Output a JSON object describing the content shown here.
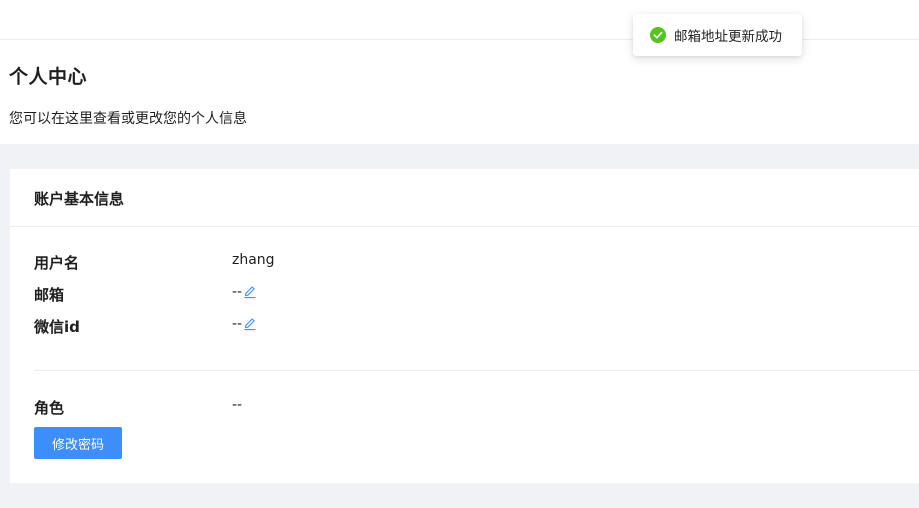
{
  "header": {
    "title": "个人中心",
    "description": "您可以在这里查看或更改您的个人信息"
  },
  "card": {
    "title": "账户基本信息",
    "fields": [
      {
        "label": "用户名",
        "value": "zhang",
        "editable": false
      },
      {
        "label": "邮箱",
        "value": "--",
        "editable": true,
        "icon": "edit-icon"
      },
      {
        "label": "微信id",
        "value": "--",
        "editable": true,
        "icon": "edit-icon"
      }
    ],
    "role": {
      "label": "角色",
      "value": "--"
    },
    "change_password_label": "修改密码"
  },
  "toast": {
    "message": "邮箱地址更新成功",
    "icon": "check-circle-icon",
    "status_color": "#52c41a"
  },
  "colors": {
    "primary": "#3d8ef8",
    "content_background": "#f0f2f5"
  }
}
